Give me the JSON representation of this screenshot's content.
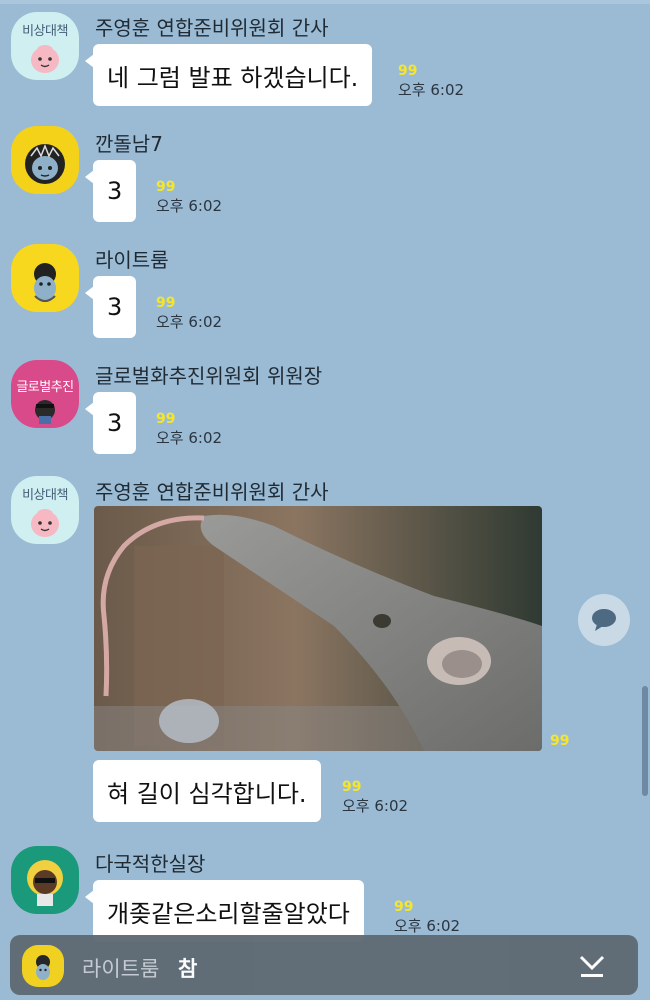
{
  "messages": [
    {
      "sender": "주영훈 연합준비위원회  간사",
      "avatar_tag": "비상대책",
      "text": "네 그럼 발표 하겠습니다.",
      "count": "99",
      "time": "오후 6:02"
    },
    {
      "sender": "깐돌남7",
      "text": "3",
      "count": "99",
      "time": "오후 6:02"
    },
    {
      "sender": "라이트룸",
      "text": "3",
      "count": "99",
      "time": "오후 6:02"
    },
    {
      "sender": "글로벌화추진위원회 위원장",
      "avatar_tag": "글로벌추진",
      "text": "3",
      "count": "99",
      "time": "오후 6:02"
    },
    {
      "sender": "주영훈 연합준비위원회  간사",
      "avatar_tag": "비상대책",
      "image_alt": "anteater-photo",
      "image_count": "99",
      "text": "혀 길이 심각합니다.",
      "count": "99",
      "time": "오후 6:02"
    },
    {
      "sender": "다국적한실장",
      "text": "개좆같은소리할줄알았다",
      "count": "99",
      "time": "오후 6:02"
    }
  ],
  "notice": {
    "sender": "라이트룸",
    "text": "참"
  },
  "colors": {
    "background": "#9bbbd4",
    "bubble": "#ffffff",
    "unread": "#f5e62a",
    "notice_bar": "#5f6a73"
  },
  "icons": [
    "speech-bubble-icon",
    "chevron-down-icon"
  ]
}
